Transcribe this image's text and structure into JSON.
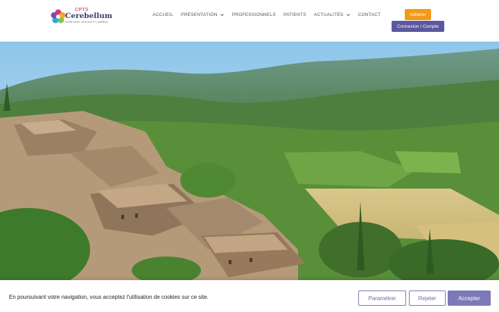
{
  "logo": {
    "cpts": "CPTS",
    "name": "Cerebellum",
    "tagline": "ENTRE MONT VENTOUX ET LUBERON"
  },
  "nav": {
    "items": [
      {
        "label": "ACCUEIL",
        "dropdown": false
      },
      {
        "label": "PRÉSENTATION",
        "dropdown": true
      },
      {
        "label": "PROFESSIONNELS",
        "dropdown": false
      },
      {
        "label": "PATIENTS",
        "dropdown": false
      },
      {
        "label": "ACTUALITÉS",
        "dropdown": true
      },
      {
        "label": "CONTACT",
        "dropdown": false
      }
    ]
  },
  "header_buttons": {
    "adherer": "Adhérer",
    "connexion": "Connexion / Compte"
  },
  "hero": {
    "icon": "landscape-photo-provence-village"
  },
  "cookie": {
    "text": "En poursuivant votre navigation, vous acceptez l'utilisation de cookies sur ce site.",
    "parametrer": "Paramétrer",
    "rejeter": "Rejeter",
    "accepter": "Accepter"
  },
  "colors": {
    "orange": "#f39a17",
    "purple": "#5b58a0",
    "cookie_purple": "#7c79b8"
  }
}
